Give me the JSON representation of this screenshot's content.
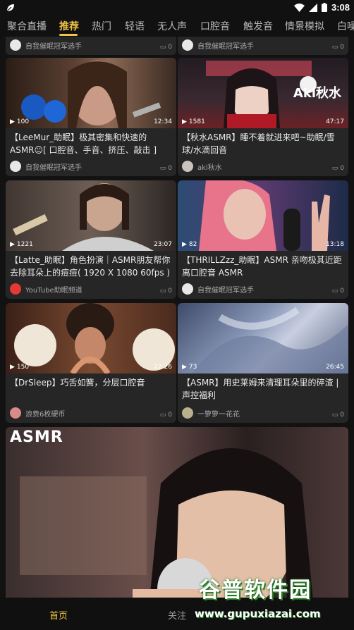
{
  "status_bar": {
    "time": "3:08"
  },
  "tabs": [
    {
      "label": "聚合直播"
    },
    {
      "label": "推荐"
    },
    {
      "label": "热门"
    },
    {
      "label": "轻语"
    },
    {
      "label": "无人声"
    },
    {
      "label": "口腔音"
    },
    {
      "label": "触发音"
    },
    {
      "label": "情景模拟"
    },
    {
      "label": "白噪"
    }
  ],
  "top_partial": [
    {
      "author": "自我催眠冠军选手",
      "comments": "0"
    },
    {
      "author": "自我催眠冠军选手",
      "comments": "0"
    }
  ],
  "cards": [
    {
      "plays": "100",
      "duration": "12:34",
      "title": "【LeeMur_助眠】极其密集和快速的 ASMR😐[ 口腔音、手音、挤压、敲击 ]",
      "author": "自我催眠冠军选手",
      "comments": "0",
      "overlay": ""
    },
    {
      "plays": "1581",
      "duration": "47:17",
      "title": "【秋水ASMR】睡不着就进来吧~助眠/雪球/水滴回音",
      "author": "aki秋水",
      "comments": "0",
      "overlay": "Aki秋水"
    },
    {
      "plays": "1221",
      "duration": "23:07",
      "title": "【Latte_助眠】角色扮演｜ASMR朋友帮你去除耳朵上的痘痘( 1920 X 1080 60fps )",
      "author": "YouTube助眠频道",
      "comments": "0",
      "overlay": ""
    },
    {
      "plays": "82",
      "duration": "13:18",
      "title": "【THRILLZzz_助眠】ASMR 亲吻极其近距离口腔音 ASMR",
      "author": "自我催眠冠军选手",
      "comments": "0",
      "overlay": ""
    },
    {
      "plays": "150",
      "duration": "22:26",
      "title": "【DrSleep】巧舌如簧，分层口腔音",
      "author": "浪费6枚硬币",
      "comments": "0",
      "overlay": ""
    },
    {
      "plays": "73",
      "duration": "26:45",
      "title": "【ASMR】用史莱姆来清理耳朵里的碎渣 |声控福利",
      "author": "一箩箩一花花",
      "comments": "0",
      "overlay": ""
    }
  ],
  "big_card": {
    "overlay": "ASMR"
  },
  "bottom_nav": {
    "home": "首页",
    "follow": "关注"
  },
  "watermark": {
    "main": "谷普软件园",
    "url": "www.gupuxiazai.com"
  },
  "colors": {
    "accent": "#f0c346",
    "background": "#121212",
    "card": "#262626"
  }
}
